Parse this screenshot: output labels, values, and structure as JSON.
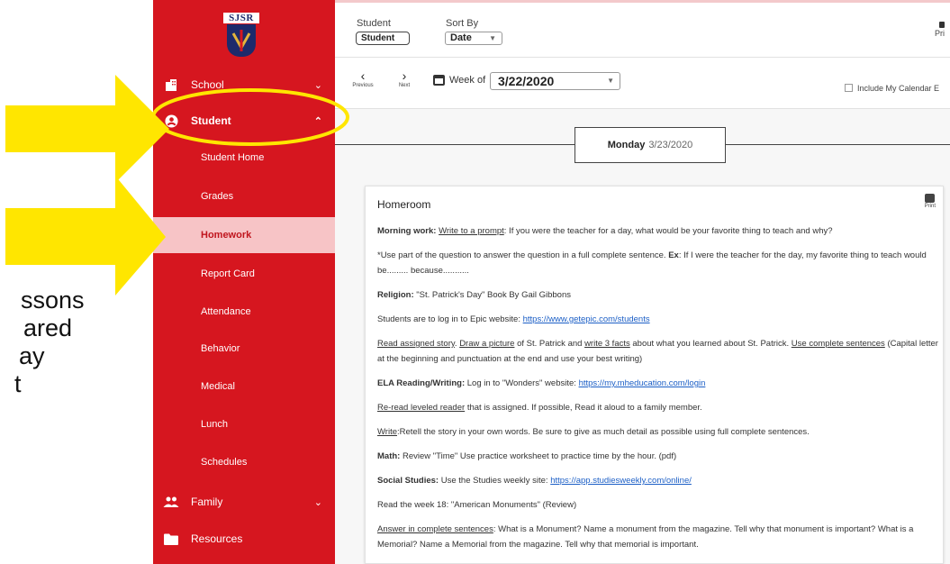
{
  "slide": {
    "lines": [
      "ssons",
      "ared",
      "ay",
      "t"
    ]
  },
  "colors": {
    "sidebar": "#d6161f",
    "active_item_bg": "#f7c4c6",
    "arrow": "#ffe600",
    "link": "#1c5fc6"
  },
  "sidebar": {
    "logo_text": "SJSR",
    "items": [
      {
        "label": "School",
        "icon": "building-icon"
      },
      {
        "label": "Student",
        "icon": "account-circle-icon"
      },
      {
        "label": "Student Home"
      },
      {
        "label": "Grades"
      },
      {
        "label": "Homework"
      },
      {
        "label": "Report Card"
      },
      {
        "label": "Attendance"
      },
      {
        "label": "Behavior"
      },
      {
        "label": "Medical"
      },
      {
        "label": "Lunch"
      },
      {
        "label": "Schedules"
      },
      {
        "label": "Family",
        "icon": "people-icon"
      },
      {
        "label": "Resources",
        "icon": "folder-icon"
      }
    ]
  },
  "toolbar": {
    "student_label": "Student",
    "student_value": "Student",
    "sort_label": "Sort By",
    "sort_value": "Date",
    "print_label": "Pri"
  },
  "week": {
    "previous_label": "Previous",
    "next_label": "Next",
    "week_of_label": "Week of",
    "week_value": "3/22/2020",
    "include_calendar_label": "Include My Calendar E"
  },
  "day": {
    "name": "Monday",
    "date": "3/23/2020"
  },
  "card": {
    "title": "Homeroom",
    "print_label": "Print",
    "p1_b": "Morning work:",
    "p1_u": "Write to a prompt",
    "p1_t": ": If you were the teacher for a day, what would be your favorite thing to teach and why?",
    "p2_a": "*Use part of the question to answer the question in a full complete sentence.",
    "p2_b": "Ex",
    "p2_c": ": If I were the teacher for the day, my favorite thing to teach would be......... because...........",
    "p3_b": "Religion:",
    "p3_t": "\"St. Patrick's Day\" Book By Gail Gibbons",
    "p4_t": "Students are to log in to Epic website:",
    "p4_link": "https://www.getepic.com/students",
    "p5_u1": "Read assigned story",
    "p5_t1": ".",
    "p5_u2": "Draw a picture",
    "p5_t2": "of St. Patrick and",
    "p5_u3": "write 3 facts",
    "p5_t3": "about what you learned about St. Patrick.",
    "p5_u4": "Use complete sentences",
    "p5_t4": "(Capital letter at the beginning and punctuation at the end and use your best writing)",
    "p6_b": "ELA Reading/Writing:",
    "p6_t": "Log in to \"Wonders\" website:",
    "p6_link": "https://my.mheducation.com/login",
    "p7_u": "Re-read leveled reader",
    "p7_t": "that is assigned. If possible, Read it aloud to a family member.",
    "p8_u": "Write",
    "p8_t": ":Retell the story in your own words. Be sure to give as much detail as possible using full complete sentences.",
    "p9_b": "Math:",
    "p9_t": "Review \"Time\" Use practice worksheet to practice time by the hour. (pdf)",
    "p10_b": "Social Studies:",
    "p10_t": "Use the Studies weekly site:",
    "p10_link": "https://app.studiesweekly.com/online/",
    "p11_t": "Read the week 18: \"American Monuments\" (Review)",
    "p12_u": "Answer in complete sentences",
    "p12_t": ": What is a Monument? Name a monument from the magazine. Tell why that monument is important? What is a Memorial? Name a Memorial from the magazine. Tell why that memorial is important."
  }
}
